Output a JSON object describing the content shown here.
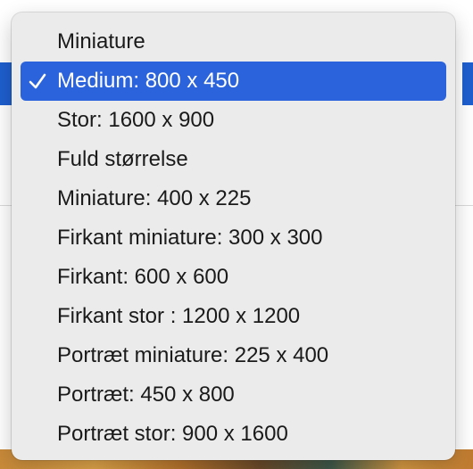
{
  "menu": {
    "selected_index": 1,
    "items": [
      {
        "label": "Miniature"
      },
      {
        "label": "Medium: 800 x 450"
      },
      {
        "label": "Stor: 1600 x 900"
      },
      {
        "label": "Fuld størrelse"
      },
      {
        "label": "Miniature: 400 x 225"
      },
      {
        "label": "Firkant miniature: 300 x 300"
      },
      {
        "label": "Firkant: 600 x 600"
      },
      {
        "label": "Firkant stor : 1200 x 1200"
      },
      {
        "label": "Portræt miniature: 225 x 400"
      },
      {
        "label": "Portræt: 450 x 800"
      },
      {
        "label": "Portræt stor: 900 x 1600"
      }
    ]
  },
  "colors": {
    "highlight": "#2b63dc",
    "menu_background": "#ebebeb",
    "text": "#1a1a1a"
  },
  "icons": {
    "selected_marker": "checkmark-icon"
  }
}
